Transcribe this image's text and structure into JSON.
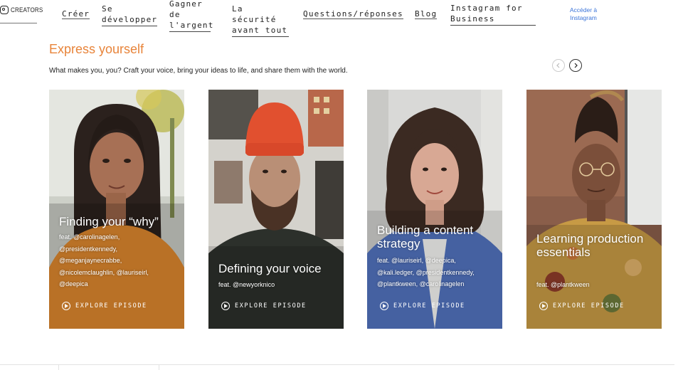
{
  "nav": {
    "brand": "CREATORS",
    "links": [
      {
        "label": "Créer"
      },
      {
        "label": "Se développer"
      },
      {
        "label": "Gagner de l'argent"
      },
      {
        "label": "La sécurité avant tout"
      },
      {
        "label": "Questions/réponses"
      },
      {
        "label": "Blog"
      },
      {
        "label": "Instagram for Business"
      }
    ],
    "cta": "Accéder à Instagram"
  },
  "section": {
    "title": "Express yourself",
    "description": "What makes you, you? Craft your voice, bring your ideas to life, and share them with the world.",
    "accent_color": "#e8843a"
  },
  "carousel": {
    "prev_icon": "chevron-left-icon",
    "next_icon": "chevron-right-icon"
  },
  "cards": [
    {
      "title": "Finding your “why”",
      "feat": [
        "feat. @carolinagelen,",
        "@presidentkennedy,",
        "@meganjaynecrabbe,",
        "@nicolemclaughlin, @lauriseirl,",
        "@deepica"
      ],
      "cta": "EXPLORE EPISODE",
      "icon": "play-icon"
    },
    {
      "title": "Defining your voice",
      "feat": [
        "feat. @newyorknico"
      ],
      "cta": "EXPLORE EPISODE",
      "icon": "play-icon"
    },
    {
      "title": "Building a content strategy",
      "feat": [
        "feat. @lauriseirl, @deepica,",
        "@kali.ledger, @presidentkennedy,",
        "@plantkween, @carolinagelen"
      ],
      "cta": "EXPLORE EPISODE",
      "icon": "play-icon"
    },
    {
      "title": "Learning production essentials",
      "feat": [
        "feat. @plantkween"
      ],
      "cta": "EXPLORE EPISODE",
      "icon": "play-icon"
    }
  ]
}
